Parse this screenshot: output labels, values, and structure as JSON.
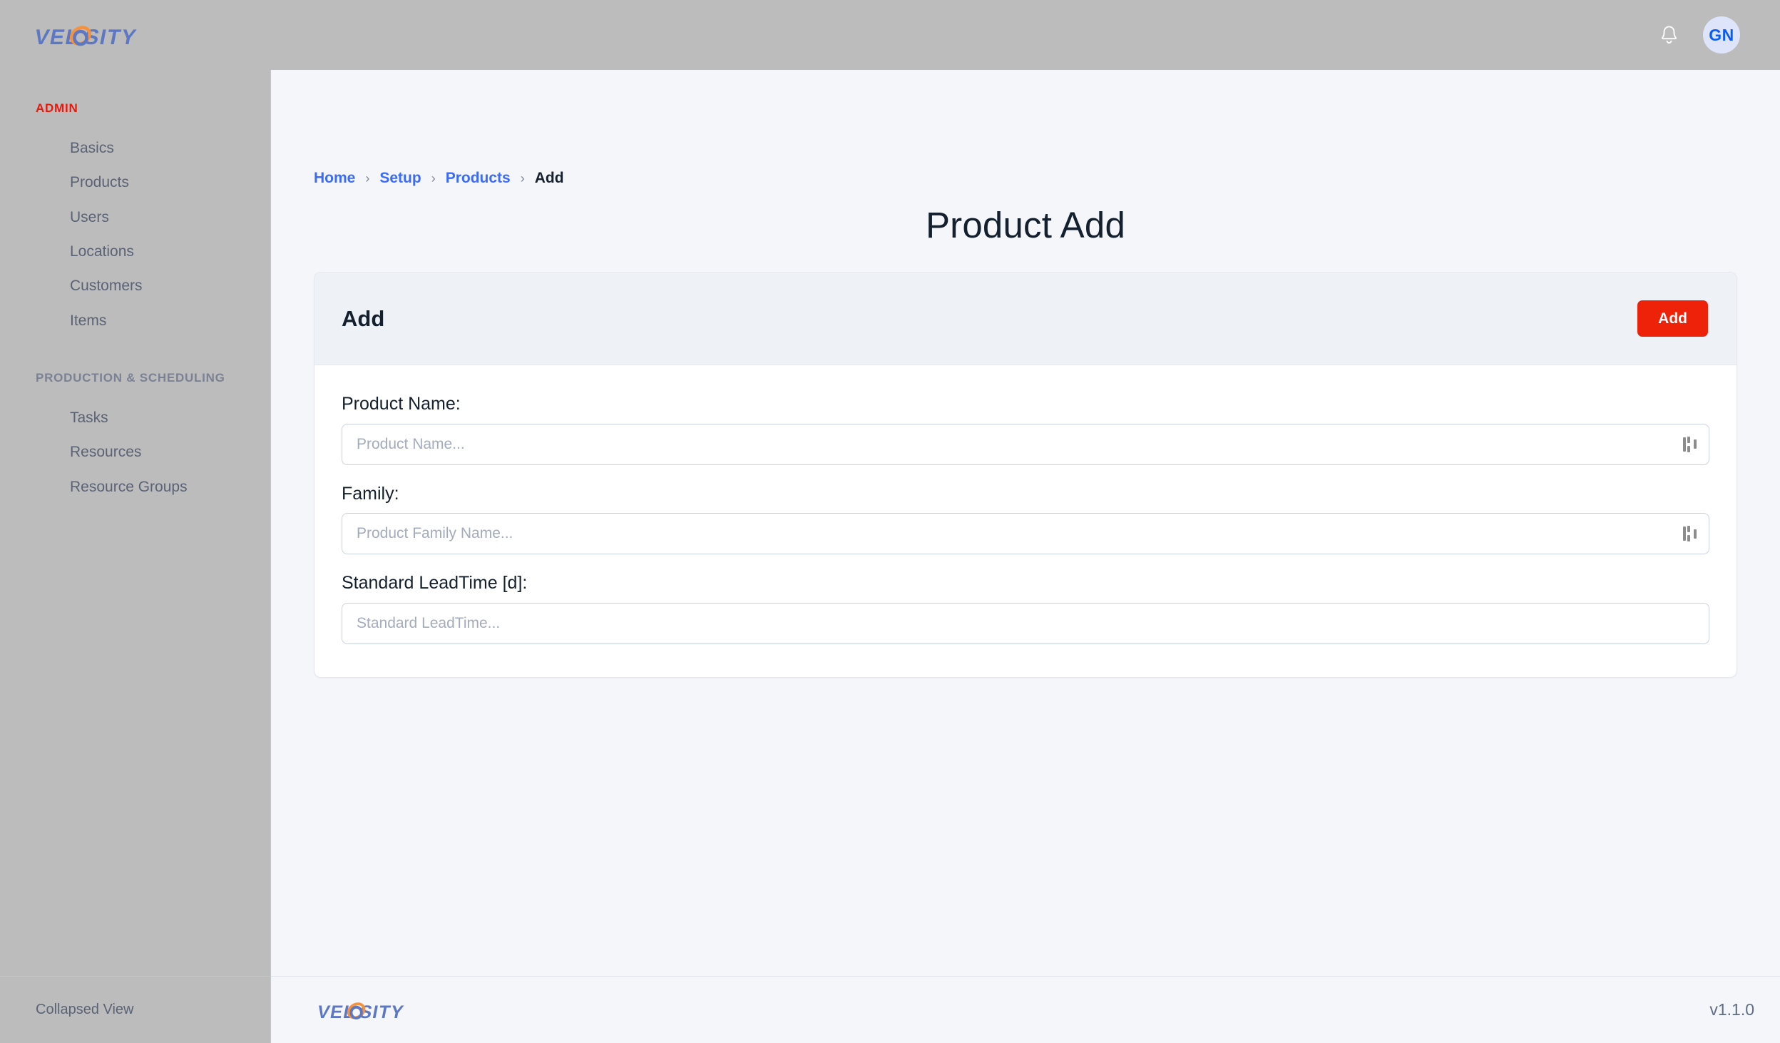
{
  "app": {
    "brand_name": "VELOSITY",
    "brand_text_color": "#5C78C4",
    "brand_accent_color": "#F5923E",
    "version": "v1.1.0"
  },
  "topbar": {
    "notifications_icon": "bell-icon",
    "avatar_initials": "GN",
    "avatar_bg": "#DEE5FA",
    "avatar_color": "#0B5CF5"
  },
  "sidebar": {
    "sections": [
      {
        "title": "ADMIN",
        "title_color": "#E8180C",
        "items": [
          {
            "label": "Basics"
          },
          {
            "label": "Products"
          },
          {
            "label": "Users"
          },
          {
            "label": "Locations"
          },
          {
            "label": "Customers"
          },
          {
            "label": "Items"
          }
        ]
      },
      {
        "title": "PRODUCTION & SCHEDULING",
        "title_color": "#7A8194",
        "items": [
          {
            "label": "Tasks"
          },
          {
            "label": "Resources"
          },
          {
            "label": "Resource Groups"
          }
        ]
      }
    ],
    "footer": {
      "collapse_label": "Collapsed View"
    }
  },
  "breadcrumb": {
    "separator": "›",
    "items": [
      {
        "label": "Home",
        "is_link": true
      },
      {
        "label": "Setup",
        "is_link": true
      },
      {
        "label": "Products",
        "is_link": true
      },
      {
        "label": "Add",
        "is_link": false
      }
    ]
  },
  "page": {
    "title": "Product Add"
  },
  "card": {
    "header_title": "Add",
    "add_button_label": "Add",
    "add_button_color": "#EE2208",
    "fields": [
      {
        "label": "Product Name:",
        "placeholder": "Product Name...",
        "value": "",
        "has_datalist": true
      },
      {
        "label": "Family:",
        "placeholder": "Product Family Name...",
        "value": "",
        "has_datalist": true
      },
      {
        "label": "Standard LeadTime [d]:",
        "placeholder": "Standard LeadTime...",
        "value": "",
        "has_datalist": false
      }
    ]
  }
}
